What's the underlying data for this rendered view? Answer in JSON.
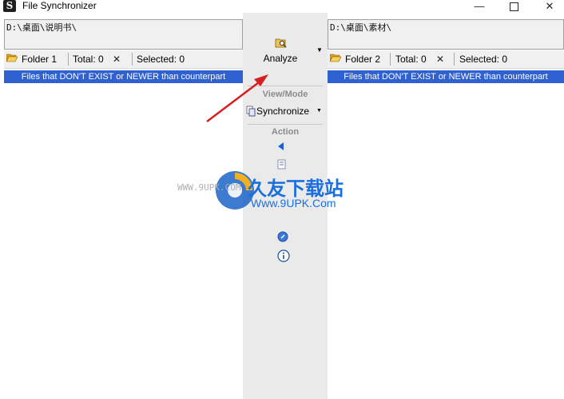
{
  "window": {
    "title": "File Synchronizer",
    "minimize_icon": "minimize-icon",
    "maximize_icon": "maximize-icon",
    "close_icon": "close-icon"
  },
  "left": {
    "path": "D:\\桌面\\说明书\\",
    "folder_label": "Folder 1",
    "total": "Total: 0",
    "selected": "Selected: 0",
    "filter": "Files that DON'T EXIST or NEWER than counterpart"
  },
  "right": {
    "path": "D:\\桌面\\素材\\",
    "folder_label": "Folder 2",
    "total": "Total: 0",
    "selected": "Selected: 0",
    "filter": "Files that DON'T EXIST or NEWER than counterpart"
  },
  "middle": {
    "analyze_label": "Analyze",
    "view_mode_heading": "View/Mode",
    "mode_label": "Synchronize",
    "action_heading": "Action"
  },
  "watermark": {
    "brand": "久友下载站",
    "url": "Www.9UPK.Com",
    "faint_text": "WWW.9UPK.COM"
  },
  "colors": {
    "filter_bar": "#3061d1",
    "annotation_arrow": "#d42020"
  }
}
